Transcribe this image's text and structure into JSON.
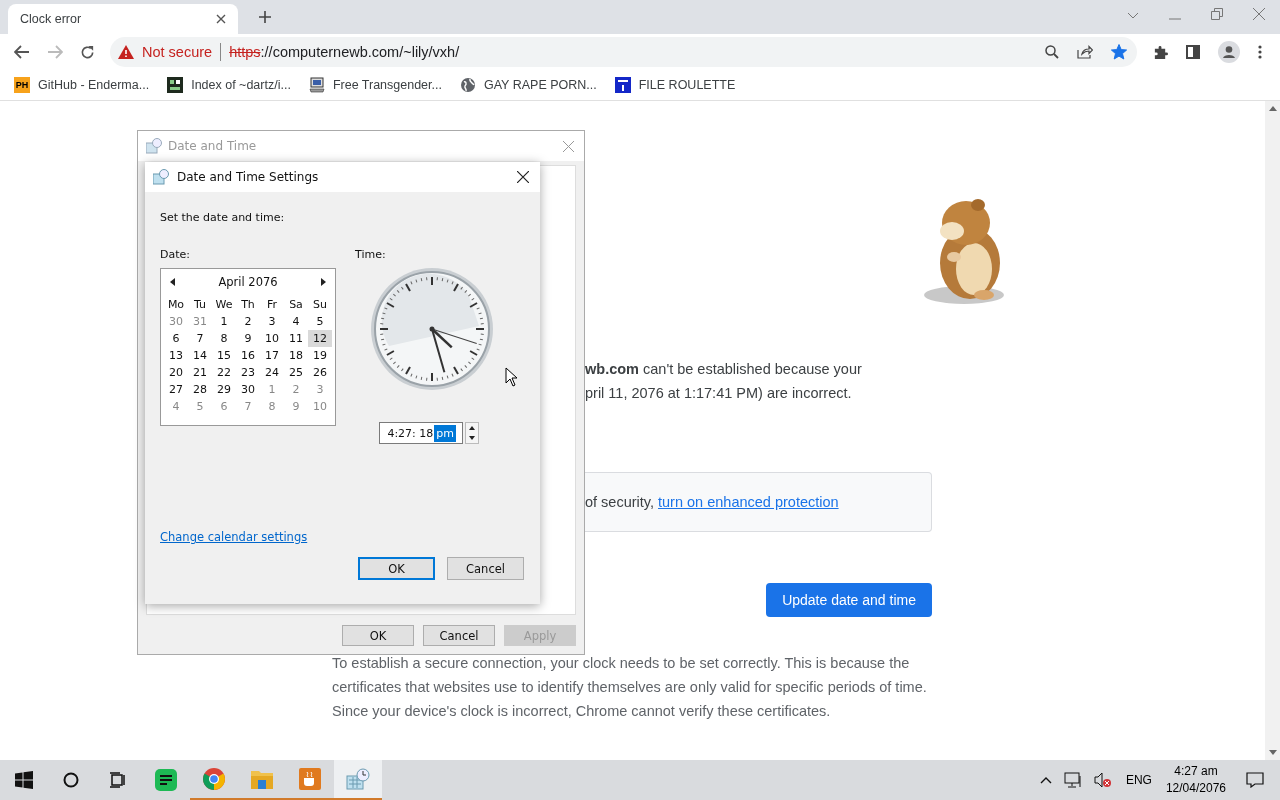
{
  "browser": {
    "tabs": [
      {
        "title": "Clock error",
        "selected": true
      }
    ],
    "forward_enabled": false,
    "security_label": "Not secure",
    "url_scheme": "https",
    "url_rest": "://computernewb.com/~lily/vxh/",
    "bookmarked": true,
    "bookmarks": [
      {
        "kind": "badge",
        "badge": "PH",
        "label": "GitHub - Enderma..."
      },
      {
        "kind": "pixel",
        "label": "Index of ~dartz/i..."
      },
      {
        "kind": "computer",
        "label": "Free Transgender..."
      },
      {
        "kind": "globe",
        "label": "GAY RAPE PORN..."
      },
      {
        "kind": "square",
        "label": "FILE ROULETTE"
      }
    ]
  },
  "page": {
    "error_lines": [
      "**wb.com** can't be established because your",
      "pril 11, 2076 at 1:17:41 PM) are incorrect."
    ],
    "protection_text": "of security, ",
    "protection_link": "turn on enhanced protection",
    "update_button": "Update date and time",
    "explanation": "To establish a secure connection, your clock needs to be set correctly. This is because the certificates that websites use to identify themselves are only valid for specific periods of time. Since your device's clock is incorrect, Chrome cannot verify these certificates."
  },
  "date_time_window": {
    "title": "Date and Time",
    "buttons": [
      {
        "label": "OK",
        "disabled": false
      },
      {
        "label": "Cancel",
        "disabled": false
      },
      {
        "label": "Apply",
        "disabled": true
      }
    ]
  },
  "settings_dialog": {
    "title": "Date and Time Settings",
    "prompt": "Set the date and time:",
    "date_label": "Date:",
    "time_label": "Time:",
    "calendar": {
      "month": "April 2076",
      "weekdays": [
        "Mo",
        "Tu",
        "We",
        "Th",
        "Fr",
        "Sa",
        "Su"
      ],
      "weeks": [
        [
          {
            "day": "30",
            "other_month": true,
            "selected": false
          },
          {
            "day": "31",
            "other_month": true,
            "selected": false
          },
          {
            "day": "1",
            "other_month": false,
            "selected": false
          },
          {
            "day": "2",
            "other_month": false,
            "selected": false
          },
          {
            "day": "3",
            "other_month": false,
            "selected": false
          },
          {
            "day": "4",
            "other_month": false,
            "selected": false
          },
          {
            "day": "5",
            "other_month": false,
            "selected": false
          }
        ],
        [
          {
            "day": "6",
            "other_month": false,
            "selected": false
          },
          {
            "day": "7",
            "other_month": false,
            "selected": false
          },
          {
            "day": "8",
            "other_month": false,
            "selected": false
          },
          {
            "day": "9",
            "other_month": false,
            "selected": false
          },
          {
            "day": "10",
            "other_month": false,
            "selected": false
          },
          {
            "day": "11",
            "other_month": false,
            "selected": false
          },
          {
            "day": "12",
            "other_month": false,
            "selected": true
          }
        ],
        [
          {
            "day": "13",
            "other_month": false,
            "selected": false
          },
          {
            "day": "14",
            "other_month": false,
            "selected": false
          },
          {
            "day": "15",
            "other_month": false,
            "selected": false
          },
          {
            "day": "16",
            "other_month": false,
            "selected": false
          },
          {
            "day": "17",
            "other_month": false,
            "selected": false
          },
          {
            "day": "18",
            "other_month": false,
            "selected": false
          },
          {
            "day": "19",
            "other_month": false,
            "selected": false
          }
        ],
        [
          {
            "day": "20",
            "other_month": false,
            "selected": false
          },
          {
            "day": "21",
            "other_month": false,
            "selected": false
          },
          {
            "day": "22",
            "other_month": false,
            "selected": false
          },
          {
            "day": "23",
            "other_month": false,
            "selected": false
          },
          {
            "day": "24",
            "other_month": false,
            "selected": false
          },
          {
            "day": "25",
            "other_month": false,
            "selected": false
          },
          {
            "day": "26",
            "other_month": false,
            "selected": false
          }
        ],
        [
          {
            "day": "27",
            "other_month": false,
            "selected": false
          },
          {
            "day": "28",
            "other_month": false,
            "selected": false
          },
          {
            "day": "29",
            "other_month": false,
            "selected": false
          },
          {
            "day": "30",
            "other_month": false,
            "selected": false
          },
          {
            "day": "1",
            "other_month": true,
            "selected": false
          },
          {
            "day": "2",
            "other_month": true,
            "selected": false
          },
          {
            "day": "3",
            "other_month": true,
            "selected": false
          }
        ],
        [
          {
            "day": "4",
            "other_month": true,
            "selected": false
          },
          {
            "day": "5",
            "other_month": true,
            "selected": false
          },
          {
            "day": "6",
            "other_month": true,
            "selected": false
          },
          {
            "day": "7",
            "other_month": true,
            "selected": false
          },
          {
            "day": "8",
            "other_month": true,
            "selected": false
          },
          {
            "day": "9",
            "other_month": true,
            "selected": false
          },
          {
            "day": "10",
            "other_month": true,
            "selected": false
          }
        ]
      ]
    },
    "time_value": "4:27: 18",
    "ampm": "pm",
    "link": "Change calendar settings",
    "buttons": [
      {
        "label": "OK",
        "default": true
      },
      {
        "label": "Cancel",
        "default": false
      }
    ]
  },
  "taskbar": {
    "apps": [
      {
        "kind": "notes",
        "running": false,
        "active": false
      },
      {
        "kind": "chrome",
        "running": true,
        "active": false
      },
      {
        "kind": "folder",
        "running": true,
        "active": false
      },
      {
        "kind": "cup",
        "running": true,
        "active": false
      },
      {
        "kind": "clock",
        "running": true,
        "active": true
      }
    ],
    "sound_muted": true,
    "language": "ENG",
    "time": "4:27 am",
    "date": "12/04/2076"
  }
}
